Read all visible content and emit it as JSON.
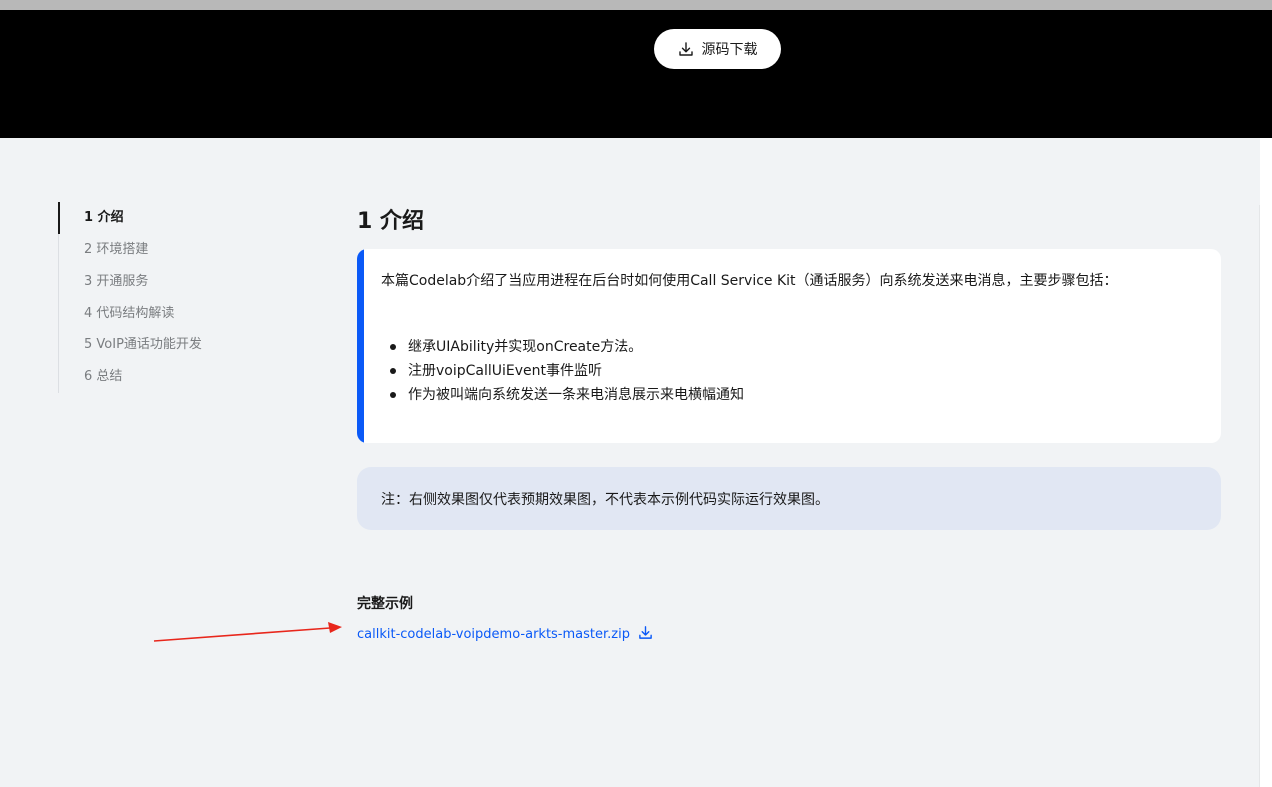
{
  "hero": {
    "download_label": "源码下载",
    "download_icon": "download-icon"
  },
  "toc": {
    "items": [
      {
        "label": "1 介绍",
        "active": true
      },
      {
        "label": "2 环境搭建",
        "active": false
      },
      {
        "label": "3 开通服务",
        "active": false
      },
      {
        "label": "4 代码结构解读",
        "active": false
      },
      {
        "label": "5 VoIP通话功能开发",
        "active": false
      },
      {
        "label": "6 总结",
        "active": false
      }
    ]
  },
  "main": {
    "section_title": "1 介绍",
    "intro_text": "本篇Codelab介绍了当应用进程在后台时如何使用Call Service Kit（通话服务）向系统发送来电消息，主要步骤包括：",
    "intro_bullets": [
      "继承UIAbility并实现onCreate方法。",
      "注册voipCallUiEvent事件监听",
      "作为被叫端向系统发送一条来电消息展示来电横幅通知"
    ],
    "note_text": "注：右侧效果图仅代表预期效果图，不代表本示例代码实际运行效果图。",
    "example_heading": "完整示例",
    "example_link": "callkit-codelab-voipdemo-arkts-master.zip",
    "example_link_icon": "download-icon"
  },
  "colors": {
    "accent": "#0a59f7",
    "hero_bg": "#000000",
    "page_bg": "#f1f3f5",
    "note_bg": "#e1e7f3",
    "annotation_arrow": "#e8261b"
  }
}
